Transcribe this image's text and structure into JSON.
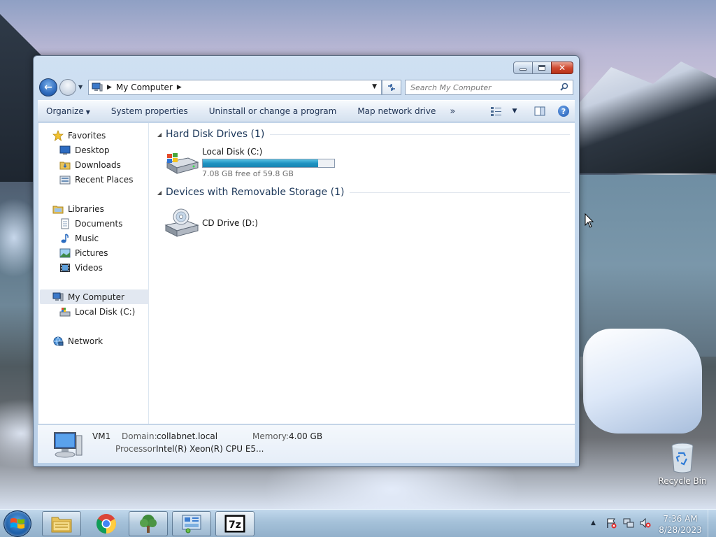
{
  "window": {
    "address": {
      "crumb": "My Computer"
    },
    "search": {
      "placeholder": "Search My Computer"
    },
    "commands": {
      "organize": "Organize",
      "system_properties": "System properties",
      "uninstall": "Uninstall or change a program",
      "map_drive": "Map network drive",
      "more": "»"
    },
    "nav_pane": {
      "favorites": "Favorites",
      "desktop": "Desktop",
      "downloads": "Downloads",
      "recent": "Recent Places",
      "libraries": "Libraries",
      "documents": "Documents",
      "music": "Music",
      "pictures": "Pictures",
      "videos": "Videos",
      "my_computer": "My Computer",
      "local_disk": "Local Disk (C:)",
      "network": "Network"
    },
    "groups": {
      "hdd_header": "Hard Disk Drives (1)",
      "removable_header": "Devices with Removable Storage (1)"
    },
    "drives": {
      "c_name": "Local Disk (C:)",
      "c_free": "7.08 GB free of 59.8 GB",
      "c_used_fraction": 0.88,
      "d_name": "CD Drive (D:)"
    },
    "details": {
      "name": "VM1",
      "domain_label": "Domain:",
      "domain_value": "collabnet.local",
      "memory_label": "Memory:",
      "memory_value": "4.00 GB",
      "processor_label": "Processor:",
      "processor_value": "Intel(R) Xeon(R) CPU E5..."
    }
  },
  "desktop": {
    "recycle_bin": "Recycle Bin"
  },
  "taskbar": {
    "time": "7:36 AM",
    "date": "8/28/2023",
    "pinned": [
      "windows-explorer",
      "chrome",
      "tree-app",
      "control-panel",
      "7zip"
    ]
  },
  "colors": {
    "accent": "#1e395b",
    "meter": "#1f93c2",
    "close": "#cf4b32"
  }
}
